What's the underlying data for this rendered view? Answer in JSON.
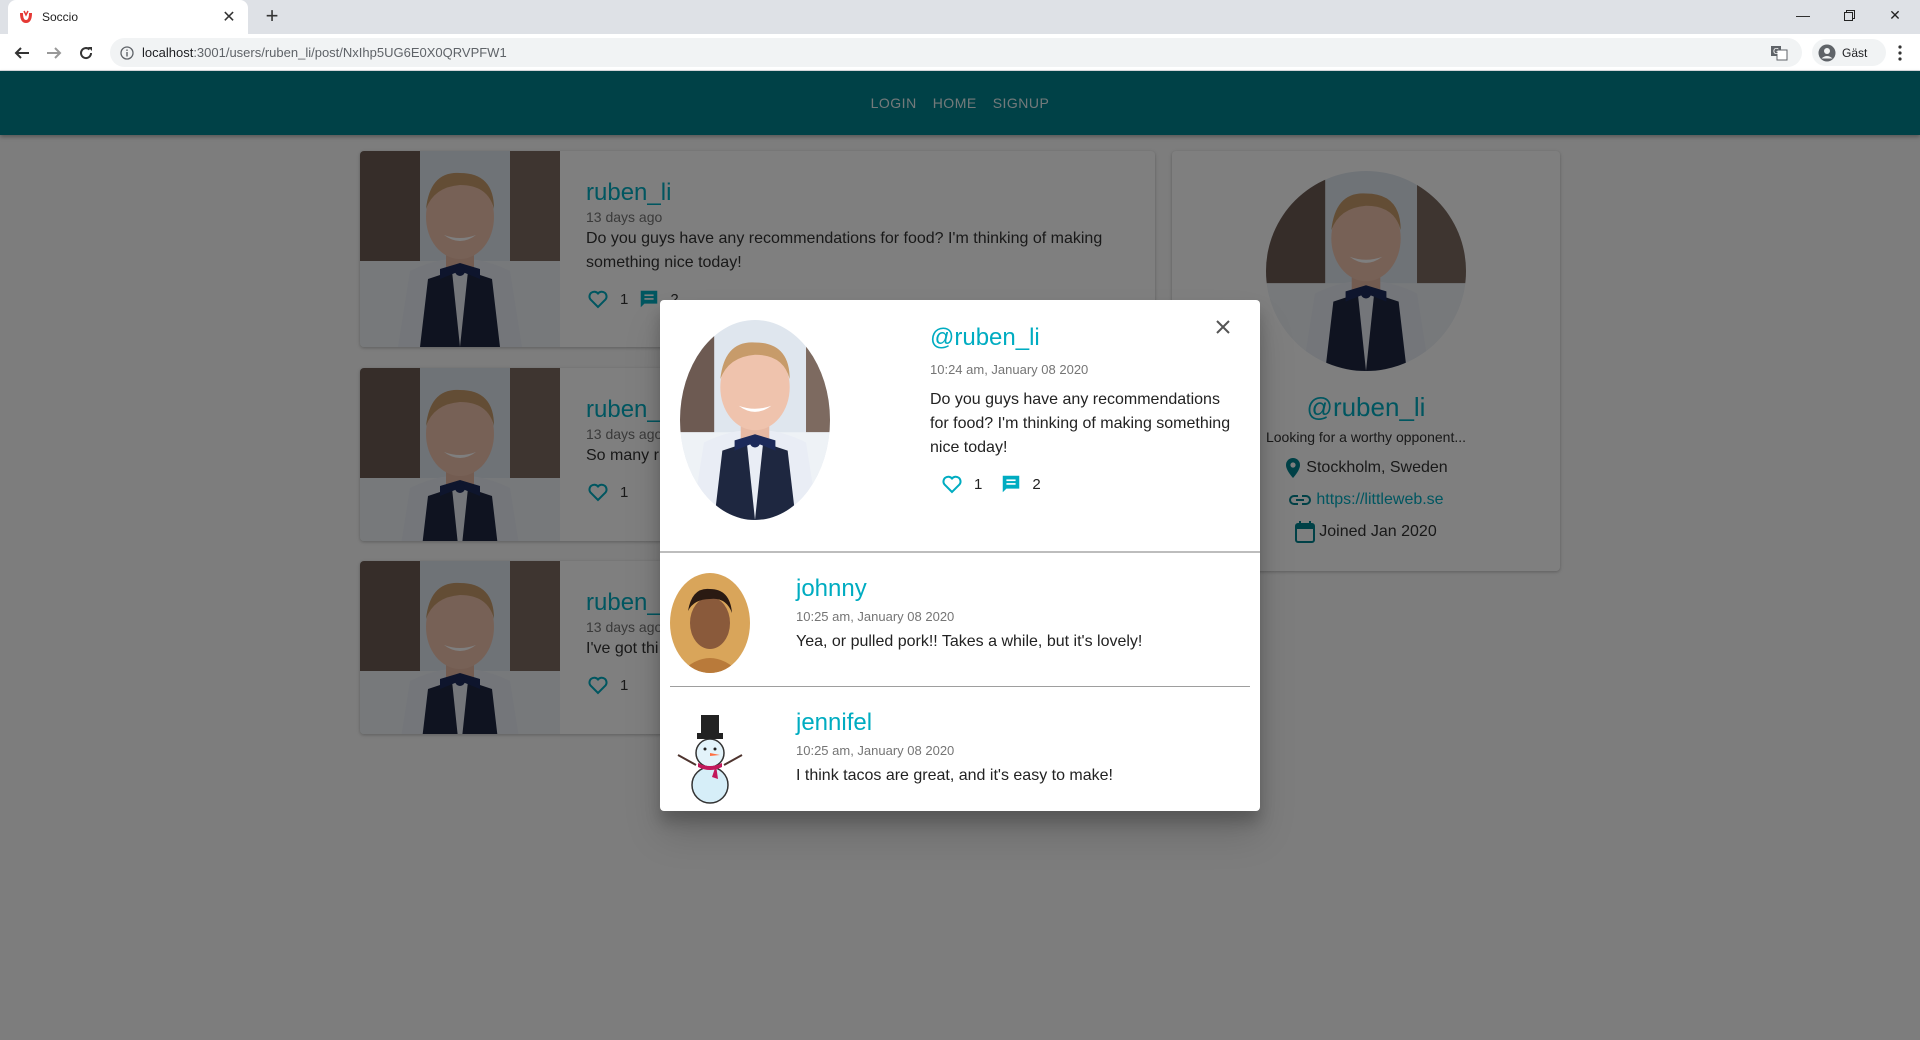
{
  "browser": {
    "tab_title": "Soccio",
    "url_host": "localhost",
    "url_path": ":3001/users/ruben_li/post/NxIhp5UG6E0X0QRVPFW1",
    "profile_label": "Gäst",
    "brand_color": "#e53935"
  },
  "nav": {
    "links": [
      "LOGIN",
      "HOME",
      "SIGNUP"
    ],
    "bar_color": "#00838f"
  },
  "posts": [
    {
      "user": "ruben_li",
      "time": "13 days ago",
      "text": "Do you guys have any recommendations for food? I'm thinking of making something nice today!",
      "likes": "1",
      "comments": "2"
    },
    {
      "user": "ruben_",
      "time": "13 days ago",
      "text": "So many r",
      "likes": "1"
    },
    {
      "user": "ruben_",
      "time": "13 days ago",
      "text": "I've got thi",
      "likes": "1"
    }
  ],
  "profile": {
    "handle": "@ruben_li",
    "bio": "Looking for a worthy opponent...",
    "location": "Stockholm, Sweden",
    "website": "https://littleweb.se",
    "joined": "Joined Jan 2020"
  },
  "dialog": {
    "user": "@ruben_li",
    "time": "10:24 am, January 08 2020",
    "text": "Do you guys have any recommendations for food? I'm thinking of making something nice today!",
    "likes": "1",
    "comments": "2",
    "comment_list": [
      {
        "user": "johnny",
        "time": "10:25 am, January 08 2020",
        "text": "Yea, or pulled pork!! Takes a while, but it's lovely!"
      },
      {
        "user": "jennifel",
        "time": "10:25 am, January 08 2020",
        "text": "I think tacos are great, and it's easy to make!"
      }
    ]
  },
  "colors": {
    "accent": "#00acc1",
    "primary": "#00838f"
  }
}
